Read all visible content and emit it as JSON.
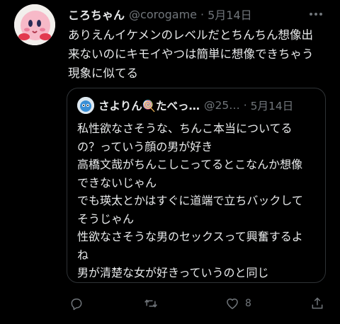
{
  "tweet": {
    "author_name": "ころちゃん",
    "handle": "@corogame",
    "separator": "·",
    "date": "5月14日",
    "text_lines": [
      "ありえんイケメンのレベルだとちんちん想像出",
      "来ないのにキモイやつは簡単に想像できちゃう",
      "現象に似てる"
    ]
  },
  "quote": {
    "author_name": "さよりん🍭たべっ…",
    "handle": "@25…",
    "separator": "·",
    "date": "5月14日",
    "text_lines": [
      "私性欲なさそうな、ちんこ本当についてる",
      "の？っていう顔の男が好き",
      "高橋文哉がちんこしこってるとこなんか想像",
      "できないじゃん",
      "でも瑛太とかはすぐに道端で立ちバックして",
      "そうじゃん",
      "性欲なさそうな男のセックスって興奮するよ",
      "ね",
      "男が清楚な女が好きっていうのと同じ"
    ]
  },
  "actions": {
    "reply_icon": "reply-icon",
    "retweet_icon": "retweet-icon",
    "like_icon": "heart-icon",
    "like_count": "8",
    "share_icon": "share-icon"
  },
  "colors": {
    "background": "#000000",
    "text": "#e7e9ea",
    "muted": "#71767b",
    "border": "#2f3336"
  }
}
